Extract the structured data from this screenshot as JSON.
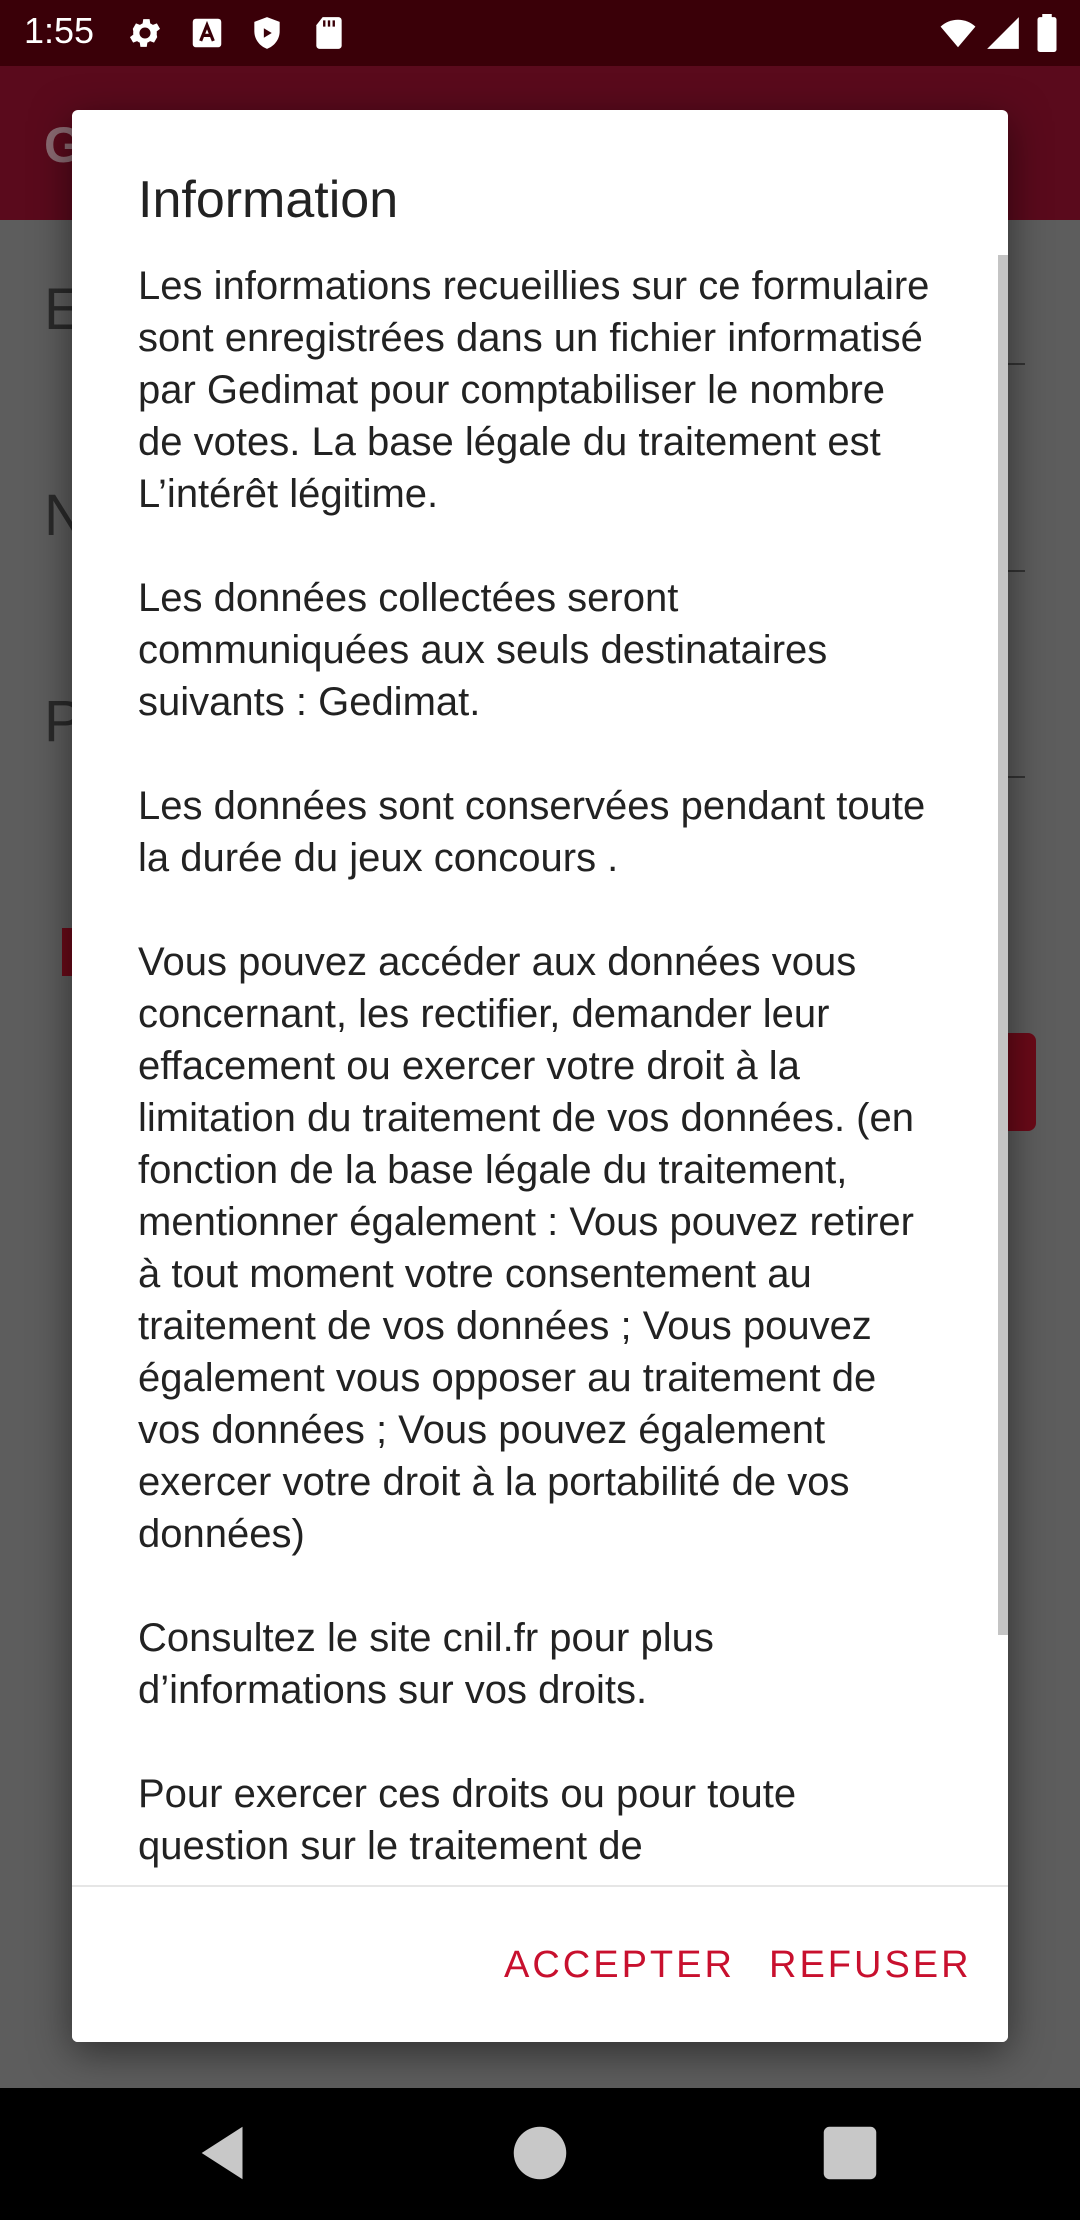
{
  "status_bar": {
    "time": "1:55",
    "left_icons": [
      "settings-icon",
      "font-icon",
      "shield-icon",
      "sd-card-icon"
    ],
    "right_icons": [
      "wifi-icon",
      "signal-icon",
      "battery-icon"
    ]
  },
  "app_bar": {
    "title": "G"
  },
  "background_fields": [
    "E",
    "N",
    "P"
  ],
  "dialog": {
    "title": "Information",
    "paragraphs": [
      "Les informations recueillies sur ce formulaire sont enregistrées dans un fichier informatisé par Gedimat pour comptabiliser le nombre de votes. La base légale du traitement est L’intérêt légitime.",
      "Les données collectées seront communiquées aux seuls destinataires suivants : Gedimat.",
      "Les données sont conservées pendant toute la durée du jeux concours .",
      "Vous pouvez accéder aux données vous concernant, les rectifier, demander leur effacement ou exercer votre droit à la limitation du traitement de vos données. (en fonction de la base légale du traitement, mentionner également : Vous pouvez retirer à tout moment votre consentement au traitement de vos données ; Vous pouvez également vous opposer au traitement de vos données ; Vous pouvez également exercer votre droit à la portabilité de vos données)",
      "Consultez le site cnil.fr pour plus d’informations sur vos droits.",
      "Pour exercer ces droits ou pour toute question sur le traitement de"
    ],
    "accept_label": "ACCEPTER",
    "refuse_label": "REFUSER"
  },
  "nav_bar": {
    "icons": [
      "back-icon",
      "home-icon",
      "recents-icon"
    ]
  },
  "colors": {
    "accent": "#c8102e",
    "status_bar": "#3a0008",
    "scrim": "#5d5d5d"
  }
}
